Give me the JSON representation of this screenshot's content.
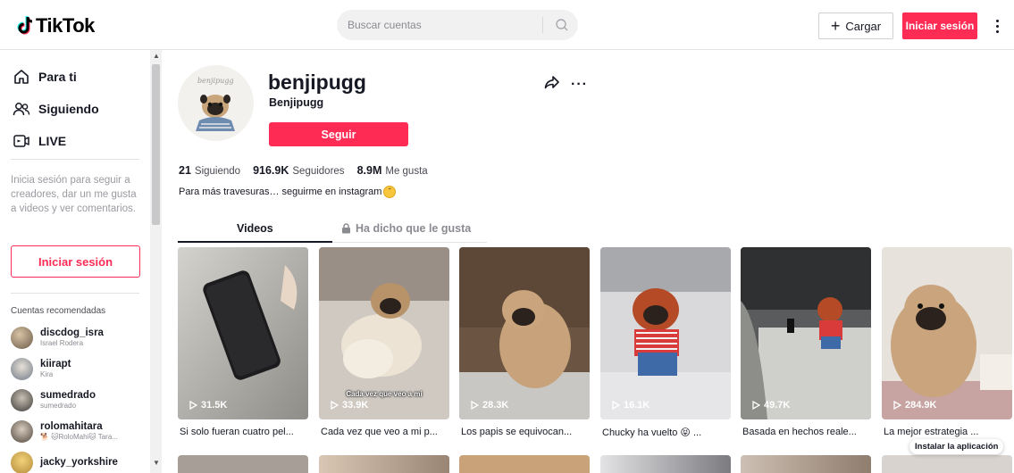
{
  "header": {
    "logo_text": "TikTok",
    "search_placeholder": "Buscar cuentas",
    "upload_label": "Cargar",
    "login_label": "Iniciar sesión"
  },
  "sidebar": {
    "nav": [
      {
        "label": "Para ti",
        "icon": "home-icon"
      },
      {
        "label": "Siguiendo",
        "icon": "following-icon"
      },
      {
        "label": "LIVE",
        "icon": "live-icon"
      }
    ],
    "login_hint": "Inicia sesión para seguir a creadores, dar un me gusta a videos y ver comentarios.",
    "login_button": "Iniciar sesión",
    "recommended_title": "Cuentas recomendadas",
    "recommended": [
      {
        "username": "discdog_isra",
        "name": "Israel Rodera"
      },
      {
        "username": "kiirapt",
        "name": "Kira"
      },
      {
        "username": "sumedrado",
        "name": "sumedrado"
      },
      {
        "username": "rolomahitara",
        "name": "🐕 🐱RoloMahi🐱 Tara..."
      },
      {
        "username": "jacky_yorkshire",
        "name": ""
      }
    ]
  },
  "profile": {
    "username": "benjipugg",
    "display_name": "Benjipugg",
    "follow_label": "Seguir",
    "following_count": "21",
    "following_label": "Siguiendo",
    "followers_count": "916.9K",
    "followers_label": "Seguidores",
    "likes_count": "8.9M",
    "likes_label": "Me gusta",
    "bio": "Para más travesuras… seguirme en instagram"
  },
  "tabs": {
    "videos": "Videos",
    "liked": "Ha dicho que le gusta"
  },
  "videos": [
    {
      "views": "31.5K",
      "caption": "Si solo fueran cuatro pel..."
    },
    {
      "views": "33.9K",
      "caption": "Cada vez que veo a mi p...",
      "overlay": "Cada vez que veo a mi"
    },
    {
      "views": "28.3K",
      "caption": "Los papis se equivocan..."
    },
    {
      "views": "16.1K",
      "caption": "Chucky ha vuelto 😝 ..."
    },
    {
      "views": "49.7K",
      "caption": "Basada en hechos reale..."
    },
    {
      "views": "284.9K",
      "caption": "La mejor estrategia ..."
    }
  ],
  "install_label": "Instalar la aplicación",
  "colors": {
    "accent": "#fe2c55",
    "text": "#161823",
    "muted": "#8a8b91"
  }
}
